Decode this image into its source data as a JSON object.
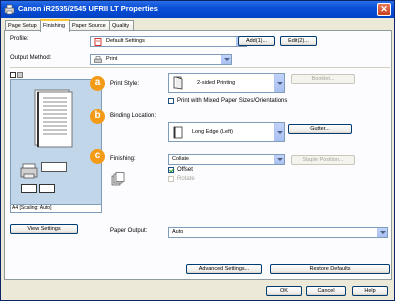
{
  "window": {
    "title": "Canon iR2535/2545 UFRII LT Properties",
    "close": "✕"
  },
  "tabs": [
    "Page Setup",
    "Finishing",
    "Paper Source",
    "Quality"
  ],
  "profile": {
    "label": "Profile:",
    "value": "Default Settings",
    "add": "Add(1)...",
    "edit": "Edit(2)..."
  },
  "output": {
    "label": "Output Method:",
    "value": "Print"
  },
  "print_style": {
    "label": "Print Style:",
    "value": "2-sided Printing",
    "booklet": "Booklet...",
    "mixed_label": "Print with Mixed Paper Sizes/Orientations",
    "mixed_checked": false
  },
  "binding": {
    "label": "Binding Location:",
    "value": "Long Edge (Left)",
    "gutter": "Gutter..."
  },
  "finishing": {
    "label": "Finishing:",
    "value": "Collate",
    "staple": "Staple Position...",
    "offset_label": "Offset",
    "offset_checked": true,
    "rotate_label": "Rotate",
    "rotate_checked": false
  },
  "badges": {
    "a": "a",
    "b": "b",
    "c": "c"
  },
  "preview": {
    "status": "A4 [Scaling: Auto]"
  },
  "view_settings": "View Settings",
  "paper_output": {
    "label": "Paper Output:",
    "value": "Auto"
  },
  "advanced": "Advanced Settings...",
  "restore": "Restore Defaults",
  "footer": {
    "ok": "OK",
    "cancel": "Cancel",
    "help": "Help"
  }
}
